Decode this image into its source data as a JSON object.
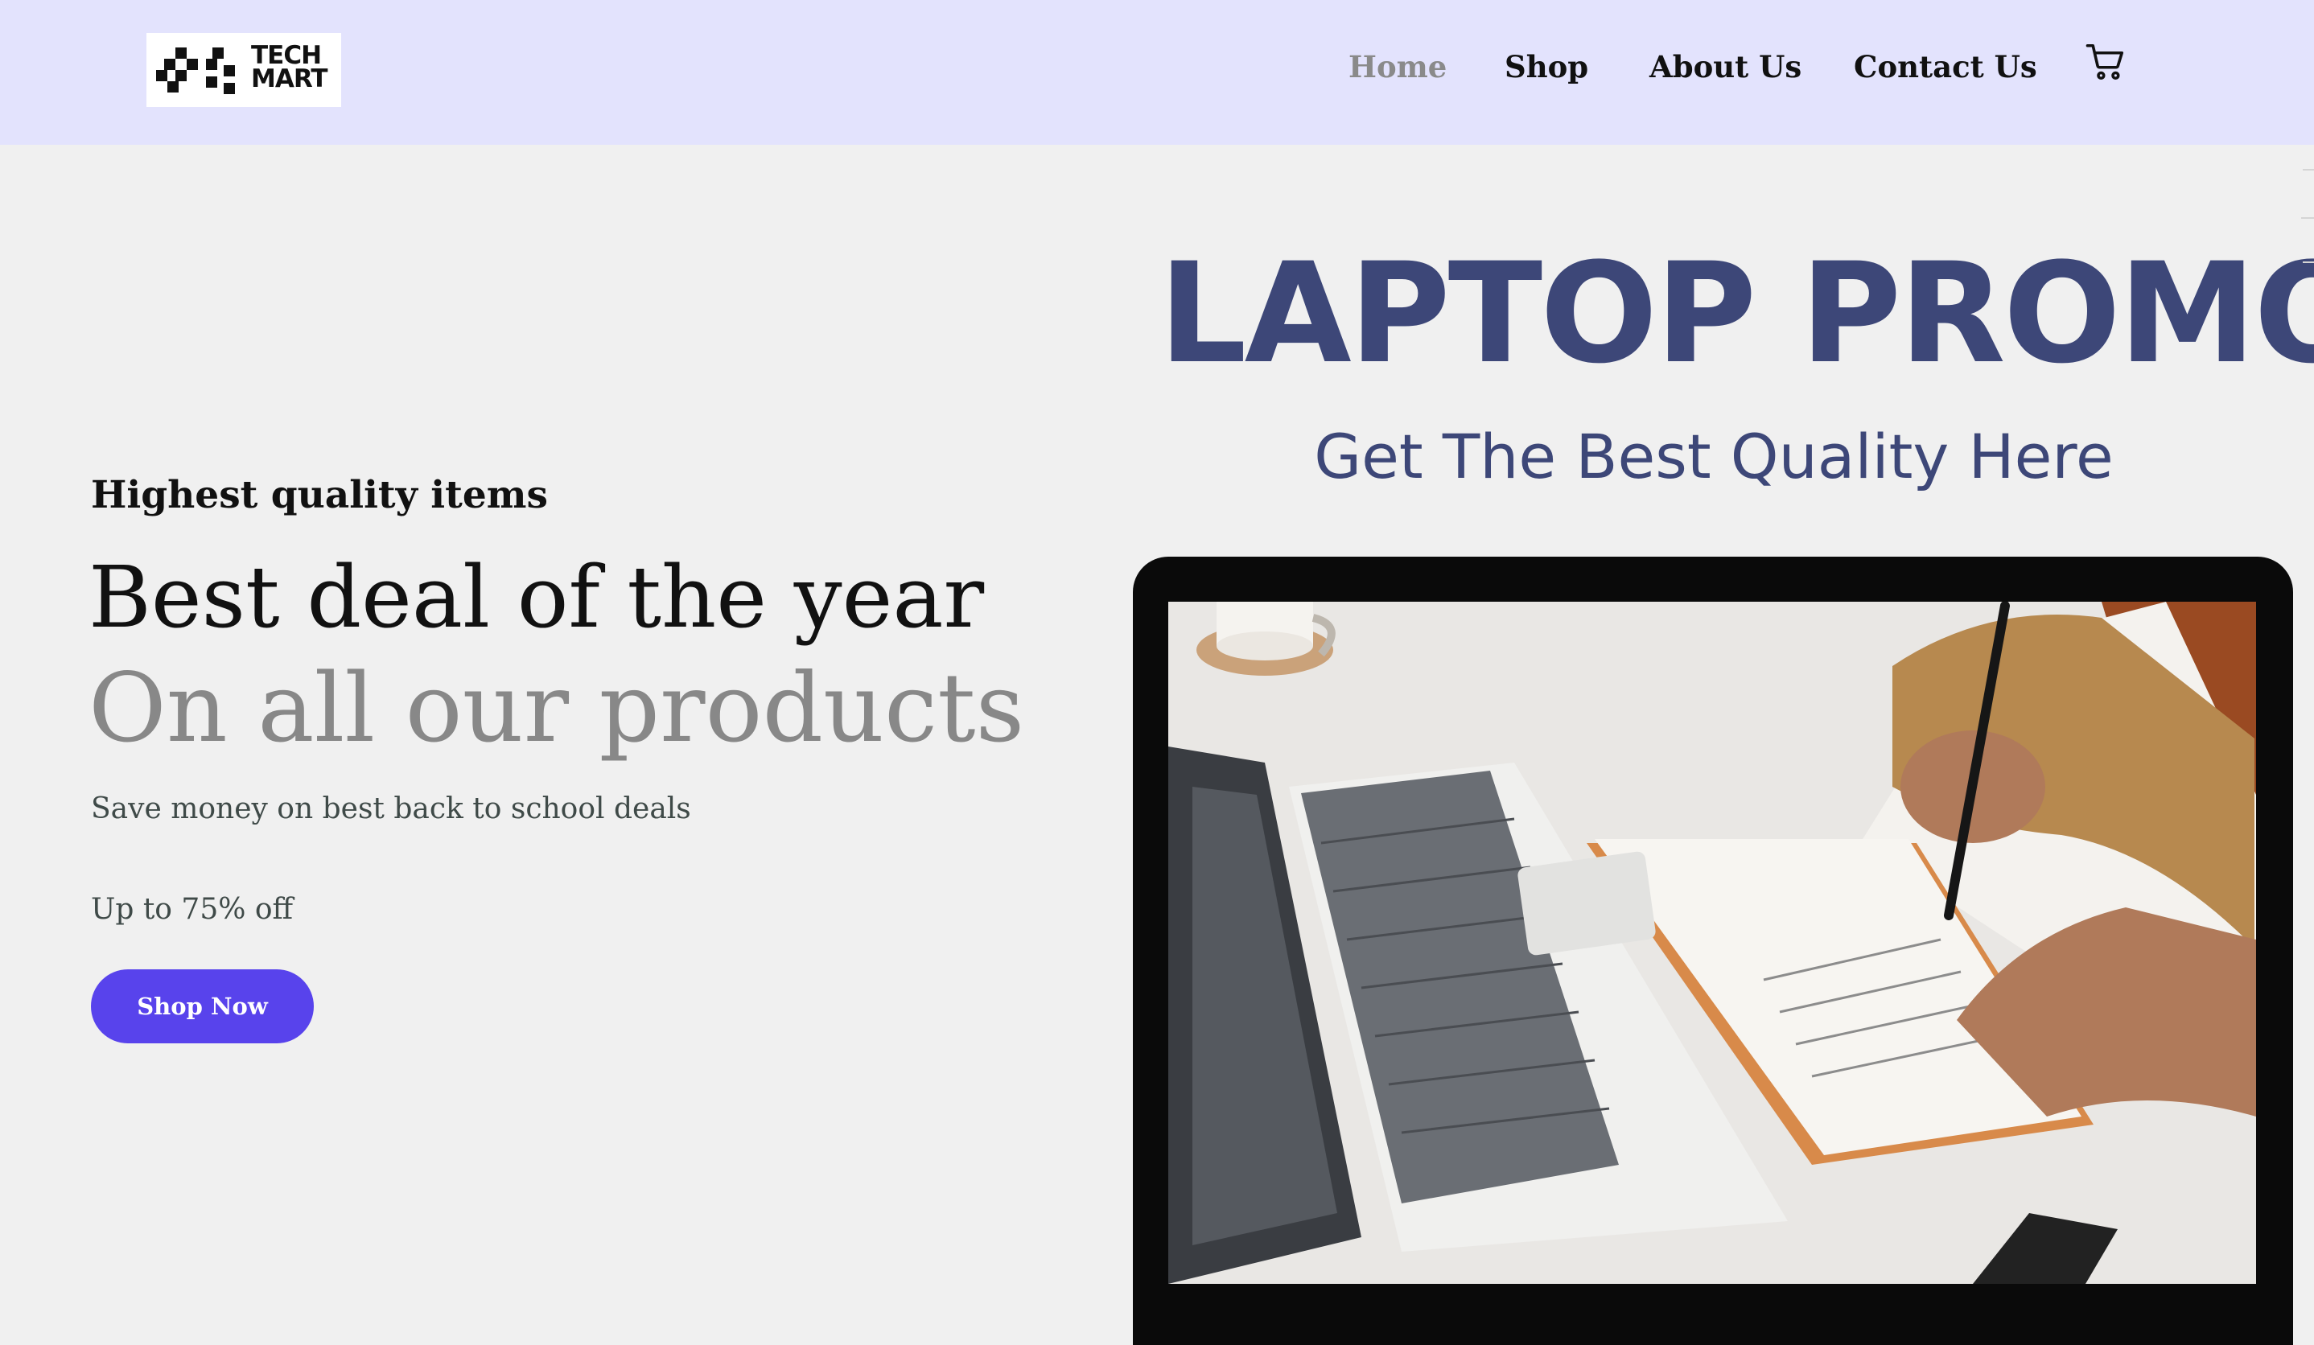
{
  "brand": {
    "logo_line1": "TECH",
    "logo_line2": "MART"
  },
  "nav": {
    "items": [
      {
        "label": "Home",
        "active": true
      },
      {
        "label": "Shop",
        "active": false
      },
      {
        "label": "About Us",
        "active": false
      },
      {
        "label": "Contact Us",
        "active": false
      }
    ],
    "cart_icon": "cart-icon"
  },
  "hero": {
    "eyebrow": "Highest quality items",
    "headline": "Best deal of the year",
    "subheadline": "On all our products",
    "description": "Save money on best back to school deals",
    "discount": "Up to 75% off",
    "cta_label": "Shop Now"
  },
  "promo": {
    "title": "LAPTOP PROMO",
    "subtitle": "Get The Best Quality Here"
  },
  "colors": {
    "header_bg": "#e3e3fd",
    "page_bg": "#f0f0f0",
    "accent": "#5843ec",
    "promo_text": "#3d4778",
    "muted_text": "#888888"
  }
}
